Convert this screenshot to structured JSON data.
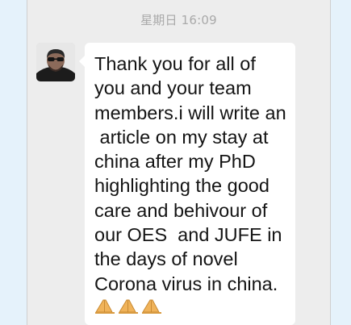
{
  "chat": {
    "timestamp": "星期日 16:09",
    "message": {
      "text": "Thank you for all of\nyou and your team\nmembers.i will write an\n article on my stay at\nchina after my PhD\nhighlighting the good\ncare and behivour of\nour OES  and JUFE in\nthe days of novel\nCorona virus in china.",
      "emoji": [
        "folded-hands-emoji",
        "folded-hands-emoji",
        "folded-hands-emoji"
      ]
    }
  },
  "colors": {
    "page_background": "#e5f2fb",
    "chat_background": "#ededed",
    "bubble_background": "#ffffff",
    "timestamp_text": "#a9a9a9",
    "message_text": "#141414",
    "emoji_skin": "#f0b35a"
  }
}
